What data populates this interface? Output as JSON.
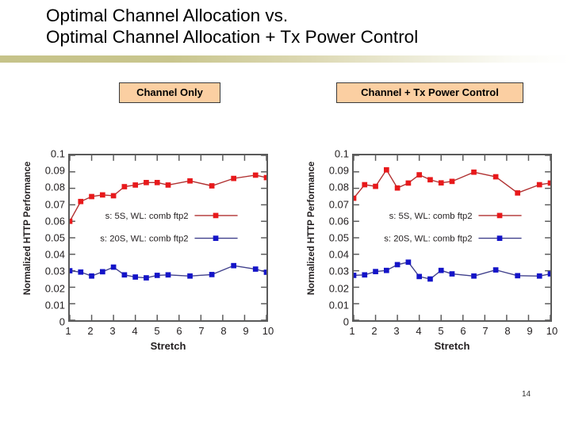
{
  "slide": {
    "title": "Optimal Channel Allocation vs.\nOptimal Channel Allocation + Tx Power Control",
    "page_number": "14",
    "divider_color_start": "#c6c389",
    "divider_color_end": "#ffffff"
  },
  "captions": {
    "left": "Channel Only",
    "right": "Channel + Tx Power Control",
    "background": "#fbcfa2",
    "border": "#3a3a3a"
  },
  "colors": {
    "series_5s": "#e8191b",
    "series_5s_line": "#b03030",
    "series_20s": "#1414c8",
    "series_20s_line": "#40408c",
    "axis": "#5a5a5a",
    "text": "#231f20"
  },
  "chart_data": [
    {
      "type": "line",
      "title": "Channel Only",
      "xlabel": "Stretch",
      "ylabel": "Normalized HTTP Performance",
      "xlim": [
        1,
        10
      ],
      "ylim": [
        0,
        0.1
      ],
      "xticks": [
        1,
        2,
        3,
        4,
        5,
        6,
        7,
        8,
        9,
        10
      ],
      "yticks": [
        0,
        0.01,
        0.02,
        0.03,
        0.04,
        0.05,
        0.06,
        0.07,
        0.08,
        0.09,
        0.1
      ],
      "ytick_labels": [
        "0",
        "0.01",
        "0.02",
        "0.03",
        "0.04",
        "0.05",
        "0.06",
        "0.07",
        "0.08",
        "0.09",
        "0.1"
      ],
      "grid": false,
      "legend_position": "center-left",
      "x": [
        1,
        1.5,
        2,
        2.5,
        3,
        3.5,
        4,
        4.5,
        5,
        5.5,
        6.5,
        7.5,
        8.5,
        9.5,
        10
      ],
      "series": [
        {
          "name": "s: 5S, WL: comb ftp2",
          "color": "#e8191b",
          "marker": "square",
          "values": [
            0.06,
            0.072,
            0.075,
            0.076,
            0.0755,
            0.081,
            0.082,
            0.0835,
            0.0835,
            0.082,
            0.0845,
            0.0815,
            0.086,
            0.088,
            0.0865
          ]
        },
        {
          "name": "s: 20S, WL: comb ftp2",
          "color": "#1414c8",
          "marker": "square",
          "values": [
            0.03,
            0.0292,
            0.0268,
            0.0294,
            0.0322,
            0.0275,
            0.0262,
            0.0257,
            0.0272,
            0.0275,
            0.0268,
            0.0277,
            0.0331,
            0.031,
            0.0291
          ]
        }
      ]
    },
    {
      "type": "line",
      "title": "Channel + Tx Power Control",
      "xlabel": "Stretch",
      "ylabel": "Normalized HTTP Performance",
      "xlim": [
        1,
        10
      ],
      "ylim": [
        0,
        0.1
      ],
      "xticks": [
        1,
        2,
        3,
        4,
        5,
        6,
        7,
        8,
        9,
        10
      ],
      "yticks": [
        0,
        0.01,
        0.02,
        0.03,
        0.04,
        0.05,
        0.06,
        0.07,
        0.08,
        0.09,
        0.1
      ],
      "ytick_labels": [
        "0",
        "0.01",
        "0.02",
        "0.03",
        "0.04",
        "0.05",
        "0.06",
        "0.07",
        "0.08",
        "0.09",
        "0.1"
      ],
      "grid": false,
      "legend_position": "center-left",
      "x": [
        1,
        1.5,
        2,
        2.5,
        3,
        3.5,
        4,
        4.5,
        5,
        5.5,
        6.5,
        7.5,
        8.5,
        9.5,
        10
      ],
      "series": [
        {
          "name": "s: 5S, WL: comb ftp2",
          "color": "#e8191b",
          "marker": "square",
          "values": [
            0.074,
            0.0822,
            0.0812,
            0.0912,
            0.0802,
            0.0832,
            0.0882,
            0.0852,
            0.0833,
            0.0842,
            0.0898,
            0.087,
            0.0772,
            0.0822,
            0.0832
          ]
        },
        {
          "name": "s: 20S, WL: comb ftp2",
          "color": "#1414c8",
          "marker": "square",
          "values": [
            0.0272,
            0.0275,
            0.0295,
            0.0302,
            0.0337,
            0.0352,
            0.0265,
            0.025,
            0.0302,
            0.0281,
            0.0268,
            0.0305,
            0.027,
            0.0268,
            0.0281
          ]
        }
      ]
    }
  ]
}
